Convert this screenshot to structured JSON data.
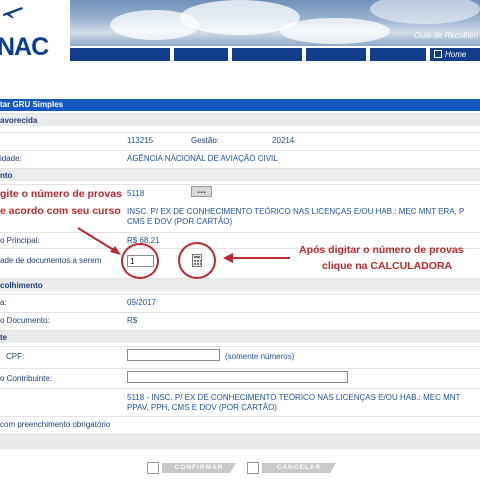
{
  "header": {
    "logo_text": "NAC",
    "title": "Guia de Recolhim",
    "nav_home": "Home"
  },
  "form": {
    "title": "tar GRU Simples",
    "sections": {
      "favorecida": "avorecida",
      "documento": "nto",
      "recolhimento": "colhimento",
      "contribuinte": "te"
    },
    "rows": {
      "ug_value": "113215",
      "gestao_label": "Gestão:",
      "gestao_value": "20214",
      "unidade_label": "idade:",
      "unidade_value": "AGÊNCIA NACIONAL DE AVIAÇÃO CIVIL",
      "codigo_value": "5118",
      "dots_button": "...",
      "descricao_line1": "INSC. P/ EX DE CONHECIMENTO TEÓRICO NAS LICENÇAS E/OU HAB.: MEC MNT ERA, P",
      "descricao_line2": "CMS E DOV (POR CARTÃO)",
      "valor_principal_label": "o Principal:",
      "valor_principal_value": "R$ 68,21",
      "quantidade_label": "ade de documentos a serem",
      "quantidade_value": "1",
      "competencia_label": "a:",
      "competencia_value": "09/2017",
      "valor_documento_label": "o Documento:",
      "valor_documento_value": "R$",
      "cpf_label": "CPF:",
      "cpf_hint": "(somente números)",
      "contribuinte_label": "o Contribuinte:",
      "resumo_line1": "5118  -  INSC. P/ EX DE CONHECIMENTO TEÓRICO NAS LICENÇAS E/OU HAB.: MEC MNT",
      "resumo_line2": "PPAV, PPH, CMS E DOV (POR CARTÃO)",
      "obrigatorio": "com preenchimento obrigatório"
    }
  },
  "annotations": {
    "left_line1": "gite o número de provas",
    "left_line2": "e acordo com seu curso",
    "right_line1": "Após digitar o número de provas",
    "right_line2": "clique na CALCULADORA"
  },
  "buttons": {
    "confirmar": "CONFIRMAR",
    "cancelar": "CANCELAR"
  },
  "colors": {
    "brand_blue": "#113d8c",
    "title_bar": "#1558c0",
    "annotation_red": "#c0262d",
    "link_blue": "#1f52a8"
  }
}
